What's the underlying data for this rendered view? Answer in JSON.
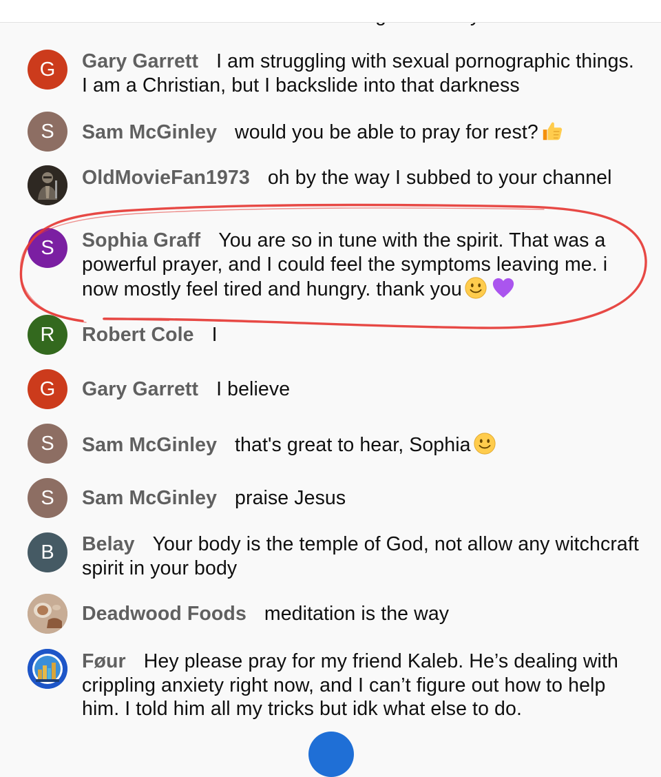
{
  "chat": {
    "partial_top_text": "Jesus Christ from the dead is living inside of you?",
    "messages": [
      {
        "author": "Gary Garrett",
        "avatar_letter": "G",
        "avatar_color": "#cc3b1c",
        "text": "I am struggling with sexual pornographic things. I am a Christian, but I backslide into that darkness"
      },
      {
        "author": "Sam McGinley",
        "avatar_letter": "S",
        "avatar_color": "#8d6e63",
        "text": "would you be able to pray for rest?",
        "emoji": "thumbs-up-icon"
      },
      {
        "author": "OldMovieFan1973",
        "avatar_image": "knight-avatar",
        "text": "oh by the way I subbed to your channel"
      },
      {
        "author": "Sophia Graff",
        "avatar_letter": "S",
        "avatar_color": "#7b1fa2",
        "text": "You are so in tune with the spirit. That was a powerful prayer, and I could feel the symptoms leaving me. i now mostly feel tired and hungry. thank you",
        "emojis": [
          "slightly-smiling-face-icon",
          "purple-heart-icon"
        ]
      },
      {
        "author": "Robert Cole",
        "avatar_letter": "R",
        "avatar_color": "#33691e",
        "text": "I"
      },
      {
        "author": "Gary Garrett",
        "avatar_letter": "G",
        "avatar_color": "#cc3b1c",
        "text": "I believe"
      },
      {
        "author": "Sam McGinley",
        "avatar_letter": "S",
        "avatar_color": "#8d6e63",
        "text": "that's great to hear, Sophia",
        "emoji": "slightly-smiling-face-icon"
      },
      {
        "author": "Sam McGinley",
        "avatar_letter": "S",
        "avatar_color": "#8d6e63",
        "text": "praise Jesus"
      },
      {
        "author": "Belay",
        "avatar_letter": "B",
        "avatar_color": "#455a64",
        "text": "Your body is the temple of God, not allow any witchcraft spirit in your body"
      },
      {
        "author": "Deadwood Foods",
        "avatar_image": "food-photo-avatar",
        "text": "meditation is the way"
      },
      {
        "author": "Føur",
        "avatar_image": "city-badge-avatar",
        "text": "Hey please pray for my friend Kaleb. He’s dealing with crippling anxiety right now, and I can’t figure out how to help him. I told him all my tricks but idk what else to do."
      }
    ]
  },
  "colors": {
    "background": "#f9f9f9",
    "author_text": "#606060",
    "message_text": "#0f0f0f",
    "annotation_circle": "#e53935",
    "fab": "#1f6fd6"
  }
}
